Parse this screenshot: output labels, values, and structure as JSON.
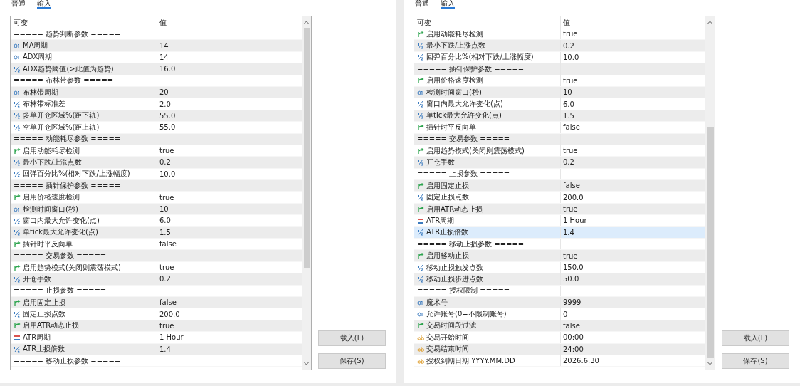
{
  "panels": [
    {
      "tabs": [
        {
          "label": "普通",
          "selected": false
        },
        {
          "label": "输入",
          "selected": true
        }
      ],
      "columns": [
        "可变",
        "值"
      ],
      "rows": [
        {
          "kind": "section",
          "name": "===== 趋势判断参数 =====",
          "value": "",
          "selected": false
        },
        {
          "kind": "int",
          "name": "MA周期",
          "value": "14",
          "selected": false
        },
        {
          "kind": "int",
          "name": "ADX周期",
          "value": "14",
          "selected": false
        },
        {
          "kind": "double",
          "name": "ADX趋势阈值(>此值为趋势)",
          "value": "16.0",
          "selected": false
        },
        {
          "kind": "section",
          "name": "===== 布林带参数 =====",
          "value": "",
          "selected": false
        },
        {
          "kind": "int",
          "name": "布林带周期",
          "value": "20",
          "selected": false
        },
        {
          "kind": "double",
          "name": "布林带标准差",
          "value": "2.0",
          "selected": false
        },
        {
          "kind": "double",
          "name": "多单开仓区域%(距下轨)",
          "value": "55.0",
          "selected": false
        },
        {
          "kind": "double",
          "name": "空单开仓区域%(距上轨)",
          "value": "55.0",
          "selected": false
        },
        {
          "kind": "section",
          "name": "===== 动能耗尽参数 =====",
          "value": "",
          "selected": false
        },
        {
          "kind": "bool",
          "name": "启用动能耗尽检测",
          "value": "true",
          "selected": false
        },
        {
          "kind": "double",
          "name": "最小下跌/上涨点数",
          "value": "0.2",
          "selected": false
        },
        {
          "kind": "double",
          "name": "回弹百分比%(相对下跌/上涨幅度)",
          "value": "10.0",
          "selected": false
        },
        {
          "kind": "section",
          "name": "===== 插针保护参数 =====",
          "value": "",
          "selected": false
        },
        {
          "kind": "bool",
          "name": "启用价格速度检测",
          "value": "true",
          "selected": false
        },
        {
          "kind": "int",
          "name": "检测时间窗口(秒)",
          "value": "10",
          "selected": false
        },
        {
          "kind": "double",
          "name": "窗口内最大允许变化(点)",
          "value": "6.0",
          "selected": false
        },
        {
          "kind": "double",
          "name": "单tick最大允许变化(点)",
          "value": "1.5",
          "selected": false
        },
        {
          "kind": "bool",
          "name": "插针时平反向单",
          "value": "false",
          "selected": false
        },
        {
          "kind": "section",
          "name": "===== 交易参数 =====",
          "value": "",
          "selected": false
        },
        {
          "kind": "bool",
          "name": "启用趋势模式(关闭则震荡模式)",
          "value": "true",
          "selected": false
        },
        {
          "kind": "double",
          "name": "开仓手数",
          "value": "0.2",
          "selected": false
        },
        {
          "kind": "section",
          "name": "===== 止损参数 =====",
          "value": "",
          "selected": false
        },
        {
          "kind": "bool",
          "name": "启用固定止损",
          "value": "false",
          "selected": false
        },
        {
          "kind": "double",
          "name": "固定止损点数",
          "value": "200.0",
          "selected": false
        },
        {
          "kind": "bool",
          "name": "启用ATR动态止损",
          "value": "true",
          "selected": false
        },
        {
          "kind": "enum",
          "name": "ATR周期",
          "value": "1 Hour",
          "selected": false
        },
        {
          "kind": "double",
          "name": "ATR止损倍数",
          "value": "1.4",
          "selected": false
        },
        {
          "kind": "section",
          "name": "===== 移动止损参数 =====",
          "value": "",
          "selected": false
        }
      ],
      "buttons": [
        "载入(L)",
        "保存(S)"
      ]
    },
    {
      "tabs": [
        {
          "label": "普通",
          "selected": false
        },
        {
          "label": "输入",
          "selected": true
        }
      ],
      "columns": [
        "可变",
        "值"
      ],
      "rows": [
        {
          "kind": "bool",
          "name": "启用动能耗尽检测",
          "value": "true",
          "selected": false
        },
        {
          "kind": "double",
          "name": "最小下跌/上涨点数",
          "value": "0.2",
          "selected": false
        },
        {
          "kind": "double",
          "name": "回弹百分比%(相对下跌/上涨幅度)",
          "value": "10.0",
          "selected": false
        },
        {
          "kind": "section",
          "name": "===== 插针保护参数 =====",
          "value": "",
          "selected": false
        },
        {
          "kind": "bool",
          "name": "启用价格速度检测",
          "value": "true",
          "selected": false
        },
        {
          "kind": "int",
          "name": "检测时间窗口(秒)",
          "value": "10",
          "selected": false
        },
        {
          "kind": "double",
          "name": "窗口内最大允许变化(点)",
          "value": "6.0",
          "selected": false
        },
        {
          "kind": "double",
          "name": "单tick最大允许变化(点)",
          "value": "1.5",
          "selected": false
        },
        {
          "kind": "bool",
          "name": "插针时平反向单",
          "value": "false",
          "selected": false
        },
        {
          "kind": "section",
          "name": "===== 交易参数 =====",
          "value": "",
          "selected": false
        },
        {
          "kind": "bool",
          "name": "启用趋势模式(关闭则震荡模式)",
          "value": "true",
          "selected": false
        },
        {
          "kind": "double",
          "name": "开仓手数",
          "value": "0.2",
          "selected": false
        },
        {
          "kind": "section",
          "name": "===== 止损参数 =====",
          "value": "",
          "selected": false
        },
        {
          "kind": "bool",
          "name": "启用固定止损",
          "value": "false",
          "selected": false
        },
        {
          "kind": "double",
          "name": "固定止损点数",
          "value": "200.0",
          "selected": false
        },
        {
          "kind": "bool",
          "name": "启用ATR动态止损",
          "value": "true",
          "selected": false
        },
        {
          "kind": "enum",
          "name": "ATR周期",
          "value": "1 Hour",
          "selected": false
        },
        {
          "kind": "double",
          "name": "ATR止损倍数",
          "value": "1.4",
          "selected": true
        },
        {
          "kind": "section",
          "name": "===== 移动止损参数 =====",
          "value": "",
          "selected": false
        },
        {
          "kind": "bool",
          "name": "启用移动止损",
          "value": "true",
          "selected": false
        },
        {
          "kind": "double",
          "name": "移动止损触发点数",
          "value": "150.0",
          "selected": false
        },
        {
          "kind": "double",
          "name": "移动止损步进点数",
          "value": "50.0",
          "selected": false
        },
        {
          "kind": "section",
          "name": "===== 授权限制 =====",
          "value": "",
          "selected": false
        },
        {
          "kind": "int",
          "name": "魔术号",
          "value": "9999",
          "selected": false
        },
        {
          "kind": "int",
          "name": "允许账号(0=不限制账号)",
          "value": "0",
          "selected": false
        },
        {
          "kind": "bool",
          "name": "交易时间段过滤",
          "value": "false",
          "selected": false
        },
        {
          "kind": "string",
          "name": "交易开始时间",
          "value": "00:00",
          "selected": false
        },
        {
          "kind": "string",
          "name": "交易结束时间",
          "value": "24:00",
          "selected": false
        },
        {
          "kind": "string",
          "name": "授权到期日期 YYYY.MM.DD",
          "value": "2026.6.30",
          "selected": false
        }
      ],
      "buttons": [
        "载入(L)",
        "保存(S)"
      ]
    }
  ]
}
